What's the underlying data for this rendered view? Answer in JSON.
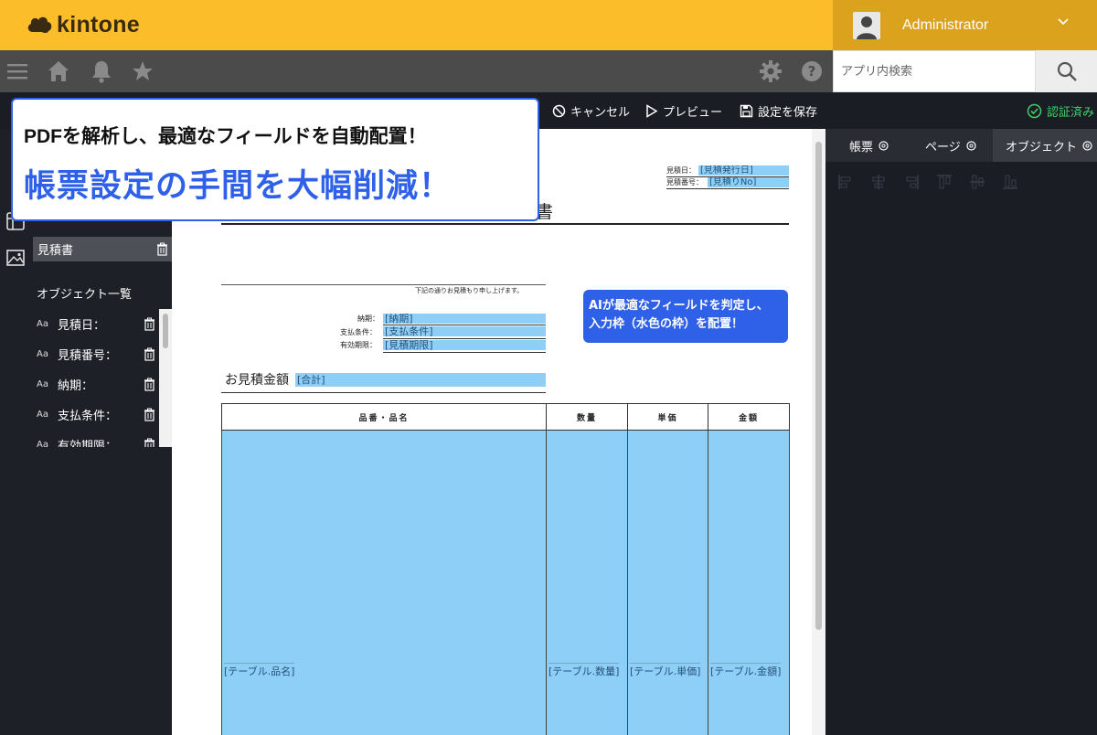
{
  "app": {
    "brand": "kintone",
    "brand_color": "#fcbd2b"
  },
  "user": {
    "name": "Administrator"
  },
  "search": {
    "placeholder": "アプリ内検索"
  },
  "toolbar": {
    "cancel_label": "キャンセル",
    "preview_label": "プレビュー",
    "save_label": "設定を保存",
    "verified_label": "認証済み"
  },
  "left_panel": {
    "selected_item": "見積書",
    "objects_heading": "オブジェクト一覧",
    "objects": [
      {
        "label": "見積日："
      },
      {
        "label": "見積番号："
      },
      {
        "label": "納期："
      },
      {
        "label": "支払条件："
      },
      {
        "label": "有効期限："
      }
    ],
    "object_type_label": "Aa"
  },
  "right_panel": {
    "tabs": [
      {
        "label": "帳票"
      },
      {
        "label": "ページ"
      },
      {
        "label": "オブジェクト"
      }
    ]
  },
  "callout": {
    "line1": "PDFを解析し、最適なフィールドを自動配置！",
    "line2": "帳票設定の手間を大幅削減！",
    "accent": "#2f60e8"
  },
  "ai_callout": {
    "line1": "AIが最適なフィールドを判定し、",
    "line2": "入力枠（水色の枠）を配置！"
  },
  "document": {
    "title_char": "書",
    "estimate_date_label": "見積日：",
    "estimate_date_field": "[見積発行日]",
    "estimate_no_label": "見積番号：",
    "estimate_no_field": "[見積りNo]",
    "note": "下記の通りお見積もり申し上げます。",
    "delivery_label": "納期：",
    "delivery_field": "[納期]",
    "payment_label": "支払条件：",
    "payment_field": "[支払条件]",
    "expiry_label": "有効期限：",
    "expiry_field": "[見積期限]",
    "amount_label": "お見積金額",
    "amount_field": "[合計]",
    "table_headers": [
      "品番・品名",
      "数量",
      "単価",
      "金額"
    ],
    "table_fields": [
      "[テーブル.品名]",
      "[テーブル.数量]",
      "[テーブル.単価]",
      "[テーブル.金額]"
    ],
    "field_color": "#8ecff7"
  }
}
